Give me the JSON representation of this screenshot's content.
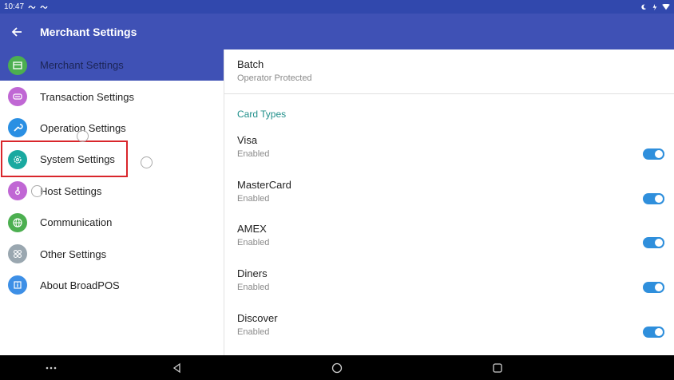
{
  "status_bar": {
    "time": "10:47"
  },
  "app_bar": {
    "title": "Merchant Settings"
  },
  "sidebar": {
    "items": [
      {
        "label": "Merchant Settings",
        "icon": "merchant-icon",
        "color": "#4caf50",
        "active": true
      },
      {
        "label": "Transaction Settings",
        "icon": "transaction-icon",
        "color": "#c067d4"
      },
      {
        "label": "Operation Settings",
        "icon": "wrench-icon",
        "color": "#2a8fe3"
      },
      {
        "label": "System Settings",
        "icon": "gear-icon",
        "color": "#1aa9a0"
      },
      {
        "label": "Host Settings",
        "icon": "key-icon",
        "color": "#c067d4"
      },
      {
        "label": "Communication",
        "icon": "globe-icon",
        "color": "#4caf50"
      },
      {
        "label": "Other Settings",
        "icon": "grid-icon",
        "color": "#9aa7b0"
      },
      {
        "label": "About BroadPOS",
        "icon": "info-icon",
        "color": "#3d8fe6"
      }
    ]
  },
  "content": {
    "batch": {
      "title": "Batch",
      "subtitle": "Operator Protected"
    },
    "section_title": "Card Types",
    "cards": [
      {
        "name": "Visa",
        "status": "Enabled",
        "enabled": true
      },
      {
        "name": "MasterCard",
        "status": "Enabled",
        "enabled": true
      },
      {
        "name": "AMEX",
        "status": "Enabled",
        "enabled": true
      },
      {
        "name": "Diners",
        "status": "Enabled",
        "enabled": true
      },
      {
        "name": "Discover",
        "status": "Enabled",
        "enabled": true
      }
    ]
  },
  "colors": {
    "primary": "#3f51b5",
    "status_bar": "#3148ad",
    "accent": "#2f8fdc",
    "section": "#1f8f8a",
    "highlight": "#d9262b"
  }
}
